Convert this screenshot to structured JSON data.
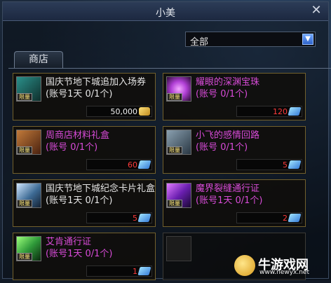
{
  "window": {
    "title": "小美",
    "close_glyph": "✕"
  },
  "filter": {
    "selected": "全部",
    "arrow_glyph": "▼"
  },
  "tabs": [
    {
      "label": "商店"
    }
  ],
  "badge_label": "限量",
  "items": [
    {
      "name": "国庆节地下城追加入场券",
      "limit": "(账号1天 0/1个)",
      "price": "50,000",
      "currency": "gold-icon",
      "name_color": "white",
      "price_color": "white",
      "icon_color": "#2a8f8a"
    },
    {
      "name": "耀眼的深渊宝珠",
      "limit": "(账号 0/1个)",
      "price": "120",
      "currency": "gem-icon",
      "name_color": "purple",
      "price_color": "red",
      "icon_color": "#b13fd6"
    },
    {
      "name": "周商店材料礼盒",
      "limit": "(账号 0/1个)",
      "price": "60",
      "currency": "gem-icon",
      "name_color": "purple",
      "price_color": "red",
      "icon_color": "#8a4a2a"
    },
    {
      "name": "小飞的感情回路",
      "limit": "(账号 0/1个)",
      "price": "5",
      "currency": "gem-icon",
      "name_color": "purple",
      "price_color": "red",
      "icon_color": "#556b7a"
    },
    {
      "name": "国庆节地下城纪念卡片礼盒",
      "limit": "(账号1天 0/1个)",
      "price": "5",
      "currency": "gem-icon",
      "name_color": "white",
      "price_color": "red",
      "icon_color": "#3d6a94"
    },
    {
      "name": "魔界裂缝通行证",
      "limit": "(账号1天 0/1个)",
      "price": "2",
      "currency": "gem-icon",
      "name_color": "purple",
      "price_color": "red",
      "icon_color": "#9a3ad0"
    },
    {
      "name": "艾肯通行证",
      "limit": "(账号1天 0/1个)",
      "price": "1",
      "currency": "gem-icon",
      "name_color": "purple",
      "price_color": "red",
      "icon_color": "#2f9a3a"
    }
  ],
  "watermark": {
    "name": "牛游戏网",
    "url": "www.newyx.net"
  }
}
